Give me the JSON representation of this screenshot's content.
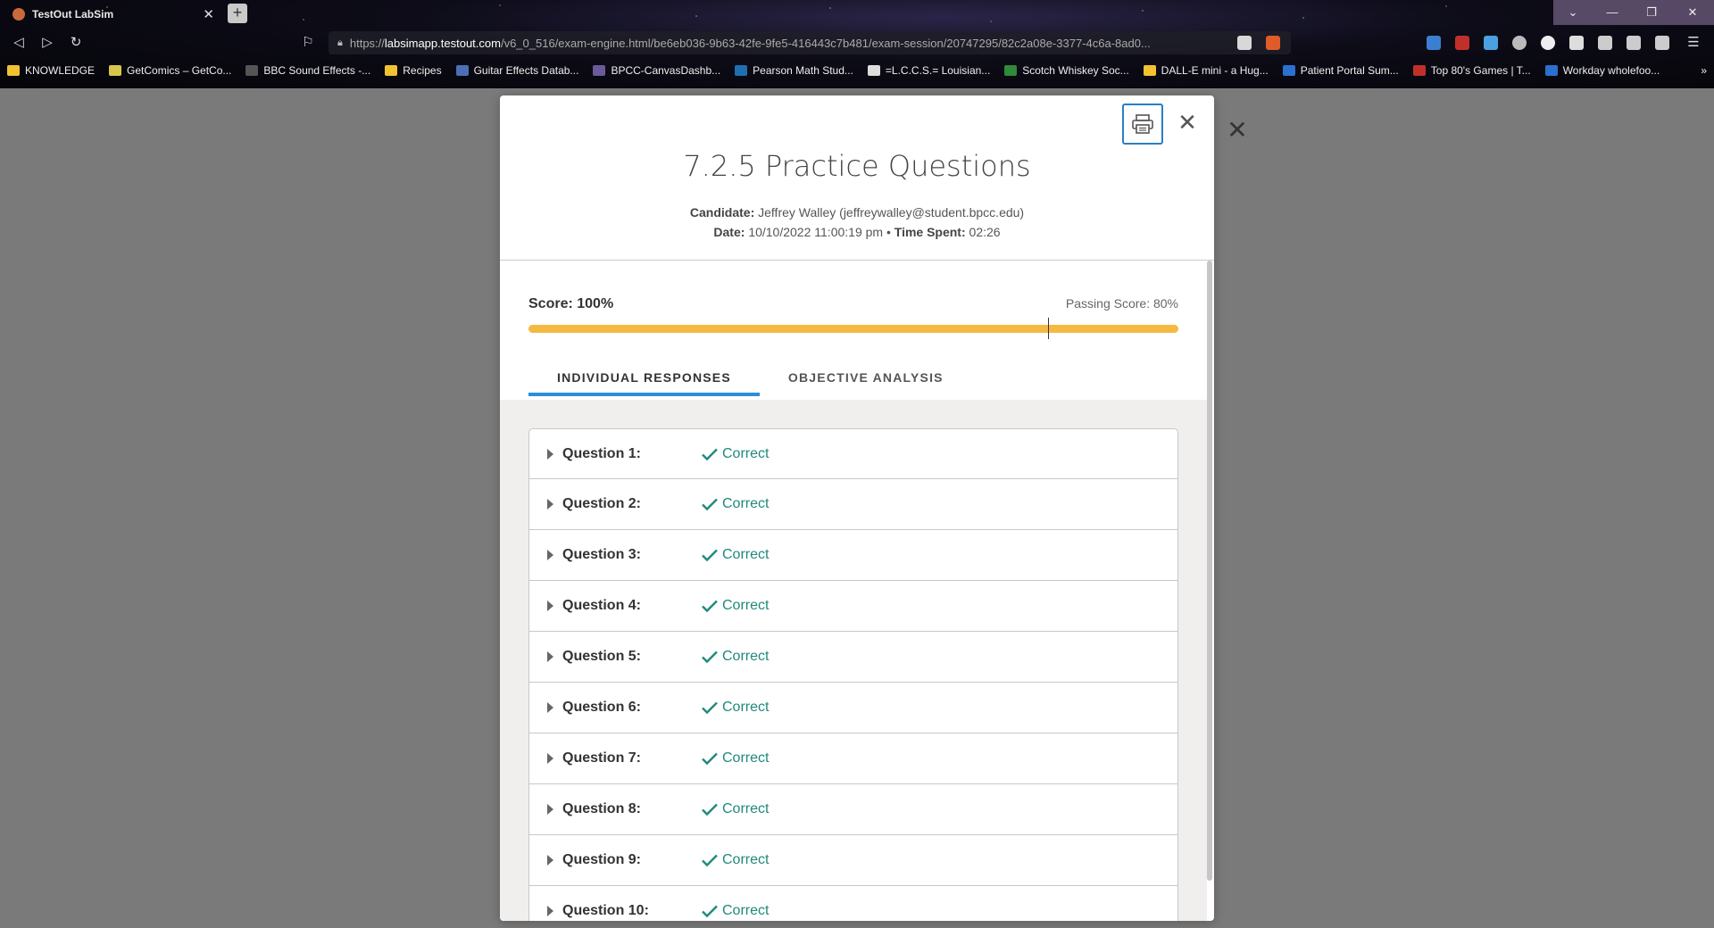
{
  "browser": {
    "tab_title": "TestOut LabSim",
    "url_host": "labsimapp.testout.com",
    "url_path": "/v6_0_516/exam-engine.html/be6eb036-9b63-42fe-9fe5-416443c7b481/exam-session/20747295/82c2a08e-3377-4c6a-8ad0...",
    "url_scheme": "https://",
    "bookmarks": [
      {
        "label": "KNOWLEDGE",
        "color": "#f2c230"
      },
      {
        "label": "GetComics – GetCo...",
        "color": "#d8c64a"
      },
      {
        "label": "BBC Sound Effects -...",
        "color": "#555555"
      },
      {
        "label": "Recipes",
        "color": "#f2c230"
      },
      {
        "label": "Guitar Effects Datab...",
        "color": "#4a6fb5"
      },
      {
        "label": "BPCC-CanvasDashb...",
        "color": "#6b5a9a"
      },
      {
        "label": "Pearson Math Stud...",
        "color": "#1f6fb0"
      },
      {
        "label": "=L.C.C.S.= Louisian...",
        "color": "#dddddd"
      },
      {
        "label": "Scotch Whiskey Soc...",
        "color": "#2f8a3a"
      },
      {
        "label": "DALL-E mini - a Hug...",
        "color": "#f2c230"
      },
      {
        "label": "Patient Portal Sum...",
        "color": "#2b6fd0"
      },
      {
        "label": "Top 80's Games | T...",
        "color": "#c0302a"
      },
      {
        "label": "Workday wholefoo...",
        "color": "#2b6fd0"
      }
    ]
  },
  "modal": {
    "title": "7.2.5 Practice Questions",
    "candidate_label": "Candidate:",
    "candidate_value": "Jeffrey Walley  (jeffreywalley@student.bpcc.edu)",
    "date_label": "Date:",
    "date_value": "10/10/2022 11:00:19 pm",
    "separator": "•",
    "time_label": "Time Spent:",
    "time_value": "02:26",
    "score_label": "Score: 100%",
    "passing_label": "Passing Score: 80%",
    "score_fraction": 1.0,
    "passing_fraction": 0.8,
    "tabs": [
      "INDIVIDUAL RESPONSES",
      "OBJECTIVE ANALYSIS"
    ],
    "active_tab": "INDIVIDUAL RESPONSES",
    "questions": [
      {
        "label": "Question 1:",
        "status": "Correct"
      },
      {
        "label": "Question 2:",
        "status": "Correct"
      },
      {
        "label": "Question 3:",
        "status": "Correct"
      },
      {
        "label": "Question 4:",
        "status": "Correct"
      },
      {
        "label": "Question 5:",
        "status": "Correct"
      },
      {
        "label": "Question 6:",
        "status": "Correct"
      },
      {
        "label": "Question 7:",
        "status": "Correct"
      },
      {
        "label": "Question 8:",
        "status": "Correct"
      },
      {
        "label": "Question 9:",
        "status": "Correct"
      },
      {
        "label": "Question 10:",
        "status": "Correct"
      }
    ]
  },
  "colors": {
    "accent_blue": "#2b8fd8",
    "score_bar": "#f5b942",
    "correct_green": "#1f8a7a"
  },
  "icons": {
    "print": "printer-icon",
    "close": "close-icon",
    "check": "checkmark-icon",
    "caret": "caret-right-icon"
  }
}
